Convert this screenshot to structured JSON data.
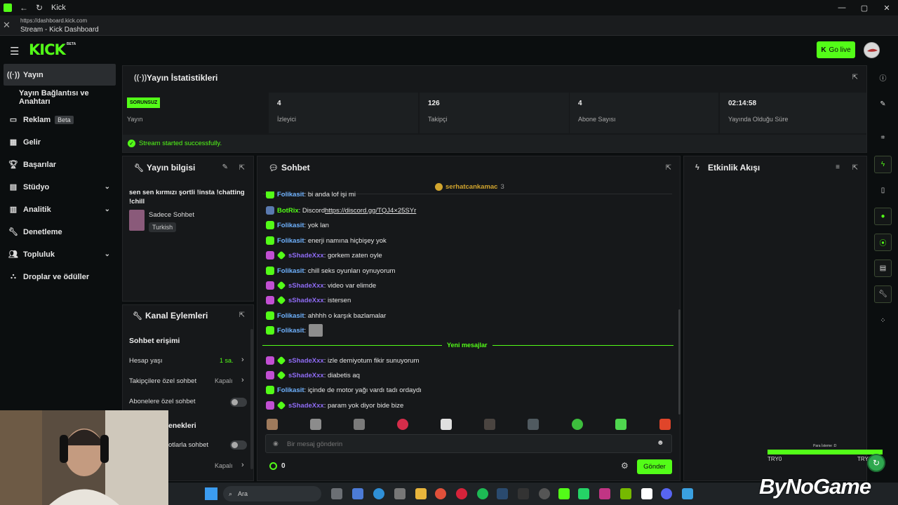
{
  "window": {
    "title": "Kick",
    "url": "https://dashboard.kick.com",
    "tab_title": "Stream - Kick Dashboard",
    "controls": [
      "—",
      "▢",
      "✕"
    ]
  },
  "header": {
    "logo": "KICK",
    "logo_badge": "BETA",
    "golive_label": "Go live"
  },
  "sidebar": {
    "items": [
      {
        "label": "Yayın",
        "icon": "broadcast-icon",
        "active": true
      },
      {
        "label": "Yayın Bağlantısı ve Anahtarı"
      },
      {
        "label": "Reklam",
        "icon": "ad-icon",
        "badge": "Beta"
      },
      {
        "label": "Gelir",
        "icon": "chart-icon"
      },
      {
        "label": "Başarılar",
        "icon": "trophy-icon"
      },
      {
        "label": "Stüdyo",
        "icon": "studio-icon",
        "chevron": "⌄"
      },
      {
        "label": "Analitik",
        "icon": "analytics-icon",
        "chevron": "⌄"
      },
      {
        "label": "Denetleme",
        "icon": "wrench-icon"
      },
      {
        "label": "Topluluk",
        "icon": "community-icon",
        "chevron": "⌄"
      },
      {
        "label": "Droplar ve ödüller",
        "icon": "drops-icon"
      }
    ]
  },
  "stats": {
    "title": "Yayın İstatistikleri",
    "status_badge": "SORUNSUZ",
    "status_label": "Yayın",
    "cells": [
      {
        "value": "4",
        "label": "İzleyici"
      },
      {
        "value": "126",
        "label": "Takipçi"
      },
      {
        "value": "4",
        "label": "Abone Sayısı"
      },
      {
        "value": "02:14:58",
        "label": "Yayında Olduğu Süre"
      }
    ],
    "success_message": "Stream started successfully."
  },
  "stream_info": {
    "title": "Yayın bilgisi",
    "stream_title": "sen sen kırmızı şortli !insta !chatting !chill",
    "category": "Sadece Sohbet",
    "language_tag": "Turkish"
  },
  "channel_actions": {
    "title": "Kanal Eylemleri",
    "section_chat_access": "Sohbet erişimi",
    "account_age_label": "Hesap yaşı",
    "account_age_value": "1 sa.",
    "followers_only_label": "Takipçilere özel sohbet",
    "followers_only_value": "Kapalı",
    "subs_only_label": "Abonelere özel sohbet",
    "section_options_partial": "enekleri",
    "emote_only_partial": "otlarla sohbet",
    "last_value": "Kapalı"
  },
  "chat": {
    "title": "Sohbet",
    "pinned_user": "serhatcankamac",
    "pinned_count": "3",
    "messages": [
      {
        "user": "Folikasit",
        "text": ": bi anda lof işi mi",
        "color": "#6fb2ff",
        "badge": "#53fc18"
      },
      {
        "user": "BotRix",
        "text": ": Discord ",
        "link": "https://discord.gg/TQJ4×25SYr",
        "color": "#53fc18",
        "badge": "#5a7ab0"
      },
      {
        "user": "Folikasit",
        "text": ": yok lan",
        "color": "#6fb2ff",
        "badge": "#53fc18"
      },
      {
        "user": "Folikasit",
        "text": ": enerji namına hiçbişey yok",
        "color": "#6fb2ff",
        "badge": "#53fc18"
      },
      {
        "user": "sShadeXxx",
        "text": ": gorkem zaten oyle",
        "color": "#8f6cf5",
        "badge": "#c24fd3"
      },
      {
        "user": "Folikasit",
        "text": ": chill seks oyunları oynuyorum",
        "color": "#6fb2ff",
        "badge": "#53fc18"
      },
      {
        "user": "sShadeXxx",
        "text": ": video var elimde",
        "color": "#8f6cf5",
        "badge": "#c24fd3"
      },
      {
        "user": "sShadeXxx",
        "text": ": istersen",
        "color": "#8f6cf5",
        "badge": "#c24fd3"
      },
      {
        "user": "Folikasit",
        "text": ": ahhhh o karşık bazlamalar",
        "color": "#6fb2ff",
        "badge": "#53fc18"
      },
      {
        "user": "Folikasit",
        "text": ":",
        "color": "#6fb2ff",
        "badge": "#53fc18",
        "emote": true
      }
    ],
    "new_messages_label": "Yeni mesajlar",
    "new_messages": [
      {
        "user": "sShadeXxx",
        "text": ": izle demiyotum fikir sunuyorum",
        "color": "#8f6cf5",
        "badge": "#c24fd3"
      },
      {
        "user": "sShadeXxx",
        "text": ": diabetis aq",
        "color": "#8f6cf5",
        "badge": "#c24fd3"
      },
      {
        "user": "Folikasit",
        "text": ": içinde de motor yağı vardı tadı ordaydı",
        "color": "#6fb2ff",
        "badge": "#53fc18"
      },
      {
        "user": "sShadeXxx",
        "text": ": param yok diyor bide bize",
        "color": "#8f6cf5",
        "badge": "#c24fd3"
      }
    ],
    "input_placeholder": "Bir mesaj gönderin",
    "points": "0",
    "send_label": "Gönder"
  },
  "activity": {
    "title": "Etkinlik Akışı"
  },
  "overlay": {
    "tryo_left": "TRY0",
    "tryo_right": "TRY0",
    "bar_label": "Para İsteme :D",
    "watermark": "ByNoGame"
  },
  "taskbar": {
    "search_label": "Ara"
  }
}
